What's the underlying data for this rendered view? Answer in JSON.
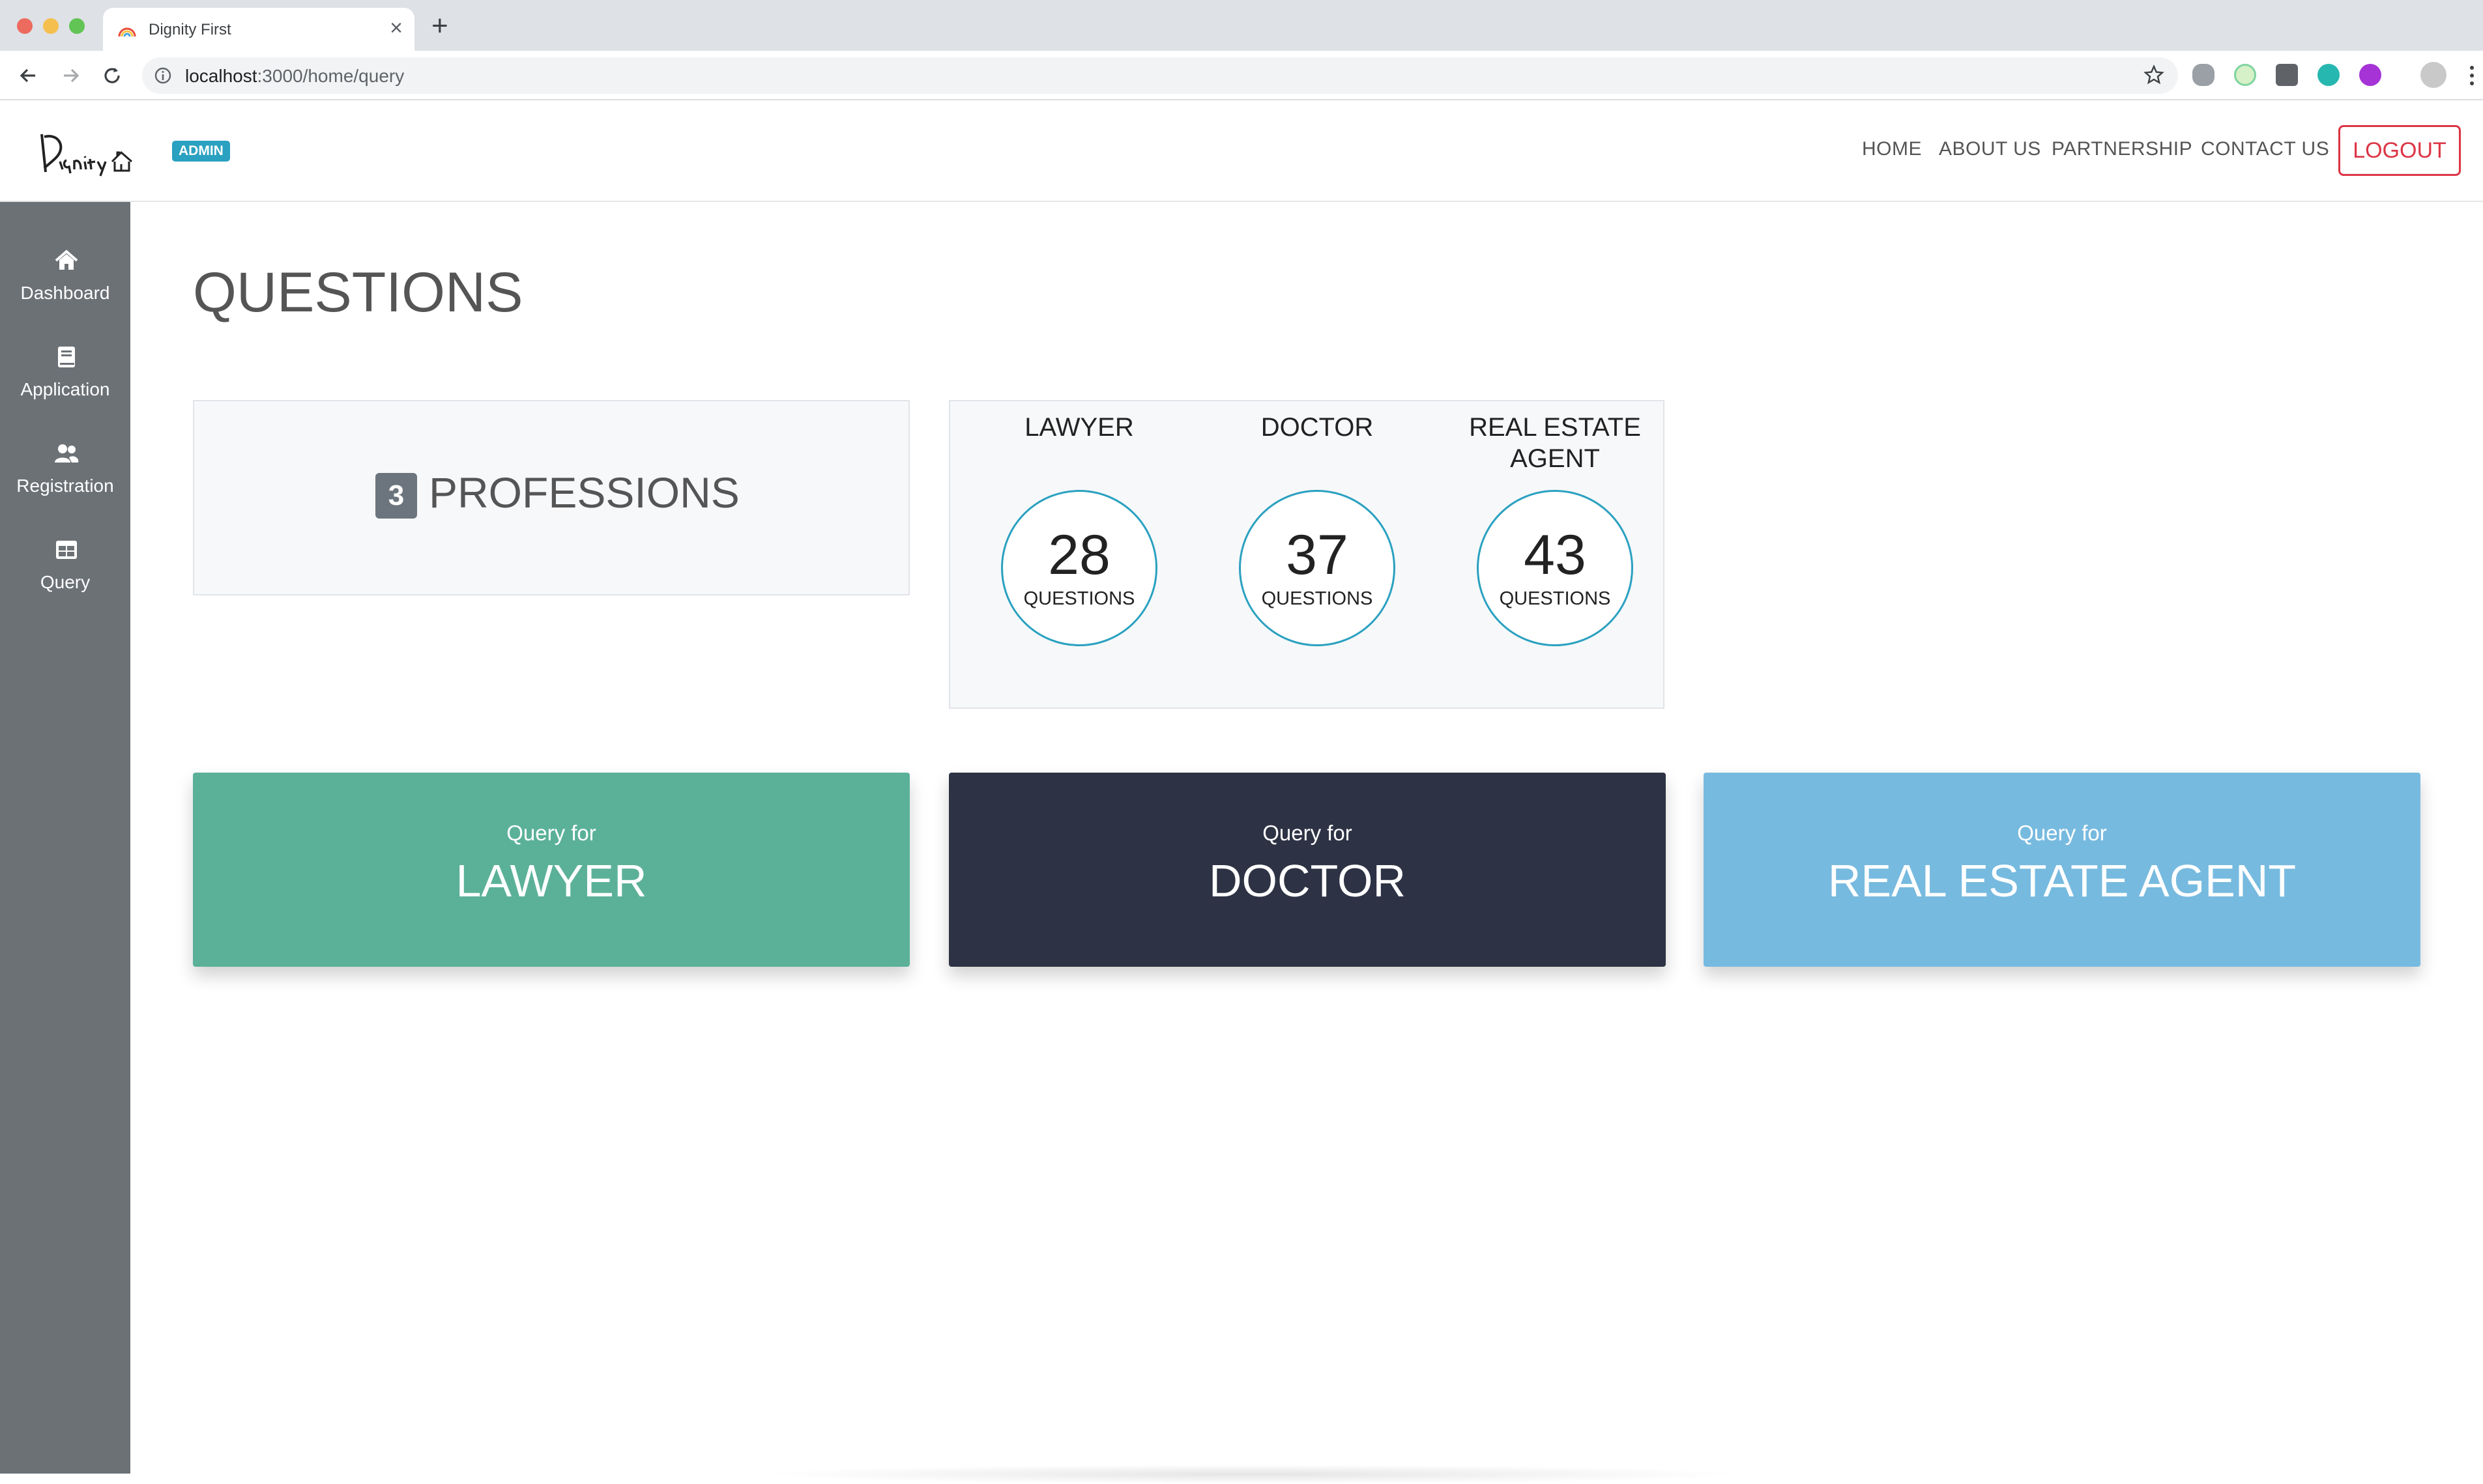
{
  "browser": {
    "tab_title": "Dignity First",
    "url_host": "localhost",
    "url_path": ":3000/home/query"
  },
  "brand": {
    "logo_icon": "dignity-first-logo",
    "badge": "ADMIN",
    "badge_color": "#2aa1c0"
  },
  "nav": {
    "links": [
      "HOME",
      "ABOUT US",
      "PARTNERSHIP",
      "CONTACT US"
    ],
    "logout": "LOGOUT",
    "logout_color": "#dc3545"
  },
  "sidebar": {
    "items": [
      {
        "label": "Dashboard",
        "icon": "home-icon"
      },
      {
        "label": "Application",
        "icon": "book-icon"
      },
      {
        "label": "Registration",
        "icon": "users-icon"
      },
      {
        "label": "Query",
        "icon": "table-icon"
      }
    ]
  },
  "main": {
    "title": "QUESTIONS",
    "professions": {
      "count": "3",
      "label": "PROFESSIONS"
    },
    "stats": [
      {
        "name": "LAWYER",
        "count": "28",
        "unit": "QUESTIONS"
      },
      {
        "name": "DOCTOR",
        "count": "37",
        "unit": "QUESTIONS"
      },
      {
        "name": "REAL ESTATE AGENT",
        "count": "43",
        "unit": "QUESTIONS"
      }
    ],
    "query_cards": [
      {
        "prefix": "Query for",
        "name": "LAWYER",
        "color": "#5bb198"
      },
      {
        "prefix": "Query for",
        "name": "DOCTOR",
        "color": "#2d3344"
      },
      {
        "prefix": "Query for",
        "name": "REAL ESTATE AGENT",
        "color": "#77badf"
      }
    ]
  }
}
